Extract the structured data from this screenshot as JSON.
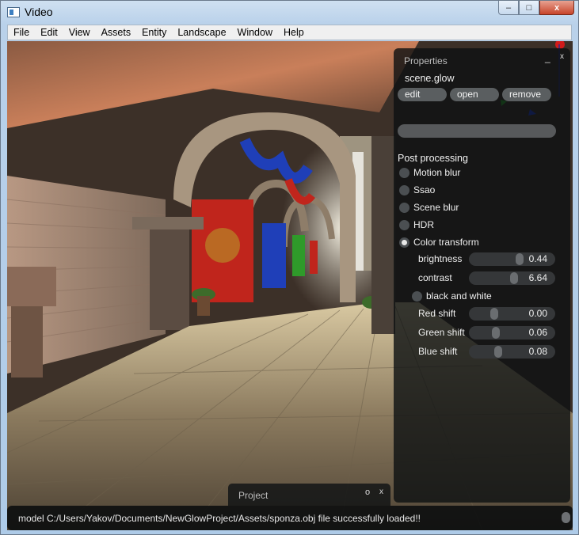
{
  "window": {
    "title": "Video",
    "buttons": {
      "minimize": "–",
      "maximize": "□",
      "close": "x"
    }
  },
  "menu": [
    "File",
    "Edit",
    "View",
    "Assets",
    "Entity",
    "Landscape",
    "Window",
    "Help"
  ],
  "properties": {
    "title": "Properties",
    "minimize": "_",
    "close": "x",
    "filename": "scene.glow",
    "buttons": {
      "edit": "edit",
      "open": "open",
      "remove": "remove"
    },
    "section": "Post processing",
    "options": [
      {
        "label": "Motion blur",
        "checked": false
      },
      {
        "label": "Ssao",
        "checked": false
      },
      {
        "label": "Scene blur",
        "checked": false
      },
      {
        "label": "HDR",
        "checked": false
      },
      {
        "label": "Color transform",
        "checked": true
      }
    ],
    "sliders_top": [
      {
        "label": "brightness",
        "value": "0.44",
        "level": 0.8
      },
      {
        "label": "contrast",
        "value": "6.64",
        "level": 0.7
      }
    ],
    "black_and_white": {
      "label": "black and white",
      "checked": false
    },
    "sliders_bottom": [
      {
        "label": "Red shift",
        "value": "0.00",
        "level": 0.35
      },
      {
        "label": "Green shift",
        "value": "0.06",
        "level": 0.38
      },
      {
        "label": "Blue shift",
        "value": "0.08",
        "level": 0.42
      }
    ]
  },
  "project": {
    "title": "Project",
    "o": "o",
    "x": "x"
  },
  "status": {
    "message": "model C:/Users/Yakov/Documents/NewGlowProject/Assets/sponza.obj file successfully loaded!!"
  },
  "colors": {
    "panel_bg": "#0c1012",
    "button_bg": "#5a5e60",
    "curtain_red": "#c0251c",
    "curtain_blue": "#1f3fb8",
    "curtain_green": "#2f9a2a"
  }
}
